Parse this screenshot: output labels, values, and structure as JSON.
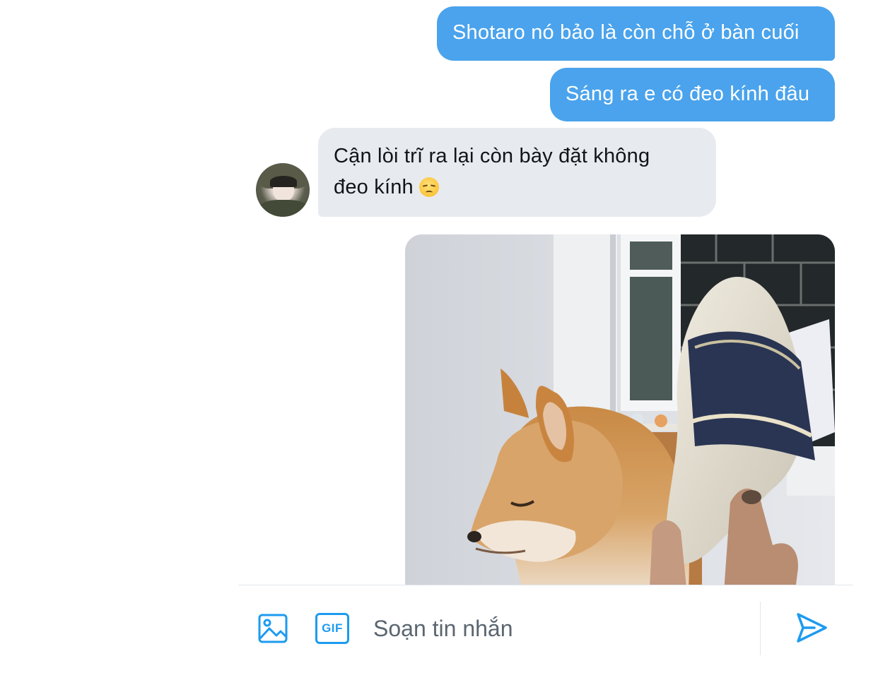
{
  "conversation": {
    "messages": [
      {
        "direction": "outgoing",
        "type": "text",
        "text": "Shotaro nó bảo là còn chỗ ở bàn cuối"
      },
      {
        "direction": "outgoing",
        "type": "text",
        "text": "Sáng ra e có đeo kính đâu"
      },
      {
        "direction": "incoming",
        "type": "text",
        "line1": "Cận lòi trĩ ra lại còn bày đặt không",
        "line2": "đeo kính",
        "emoji": "unamused-face-emoji"
      },
      {
        "direction": "outgoing",
        "type": "image",
        "image": "shiba-dog-slipper-photo"
      }
    ],
    "incoming_avatar": "contact-avatar"
  },
  "composer": {
    "placeholder": "Soạn tin nhắn",
    "value": "",
    "image_icon": "image-icon",
    "gif_label": "GIF",
    "send_icon": "send-icon",
    "accent_color": "#1d9bf0"
  },
  "colors": {
    "outgoing_bubble": "#4aa3ec",
    "incoming_bubble": "#e7ebef"
  }
}
